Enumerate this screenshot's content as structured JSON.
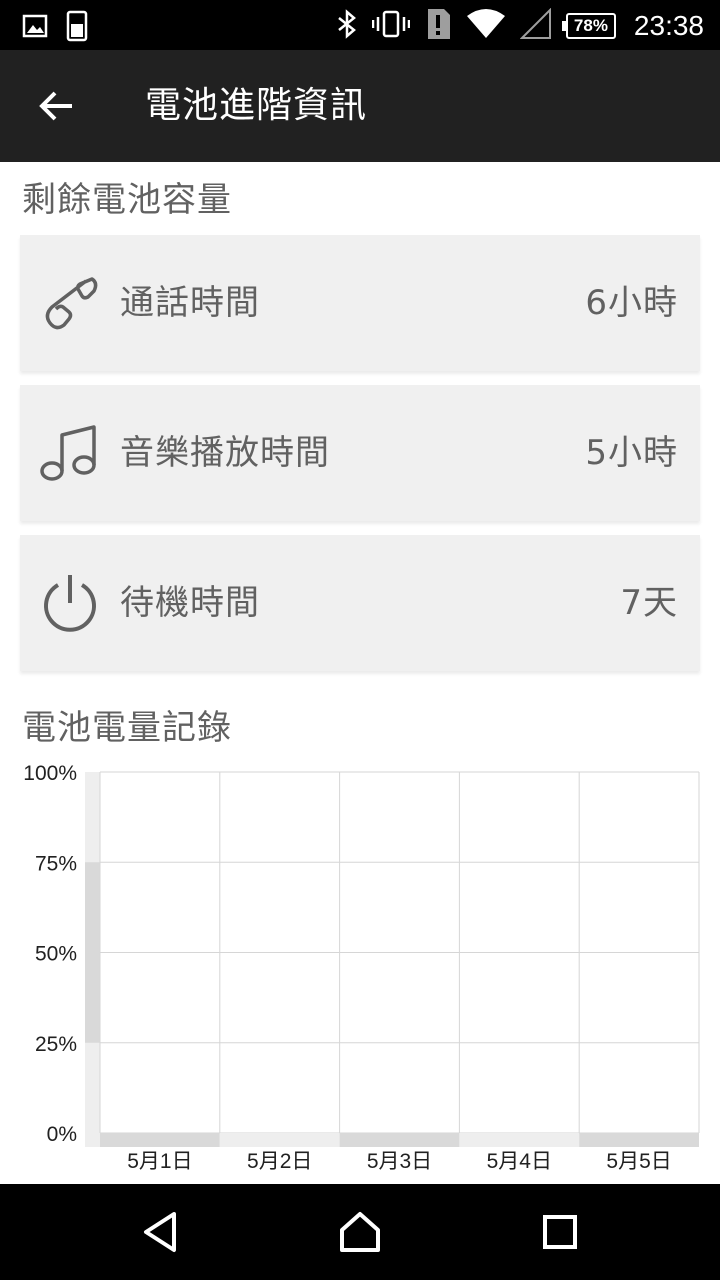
{
  "status_bar": {
    "time": "23:38",
    "battery_percent": "78%",
    "icons": [
      "image-icon",
      "phone-battery-icon",
      "bluetooth-icon",
      "vibrate-icon",
      "alert-icon",
      "wifi-icon",
      "signal-icon"
    ]
  },
  "app_bar": {
    "title": "電池進階資訊",
    "back_icon": "arrow-left-icon"
  },
  "remaining_section": {
    "header": "剩餘電池容量",
    "items": [
      {
        "icon": "phone-icon",
        "label": "通話時間",
        "value": "6小時"
      },
      {
        "icon": "music-note-icon",
        "label": "音樂播放時間",
        "value": "5小時"
      },
      {
        "icon": "power-icon",
        "label": "待機時間",
        "value": "7天"
      }
    ]
  },
  "history_section": {
    "header": "電池電量記錄"
  },
  "chart_data": {
    "type": "area",
    "title": "",
    "xlabel": "",
    "ylabel": "",
    "y_ticks": [
      "100%",
      "75%",
      "50%",
      "25%",
      "0%"
    ],
    "ylim": [
      0,
      100
    ],
    "categories": [
      "5月1日",
      "5月2日",
      "5月3日",
      "5月4日",
      "5月5日"
    ],
    "grid": true,
    "series": [
      {
        "values": [
          0,
          0,
          0,
          0,
          0
        ]
      }
    ]
  },
  "nav_bar": {
    "buttons": [
      "back-triangle-icon",
      "home-icon",
      "recents-icon"
    ]
  }
}
